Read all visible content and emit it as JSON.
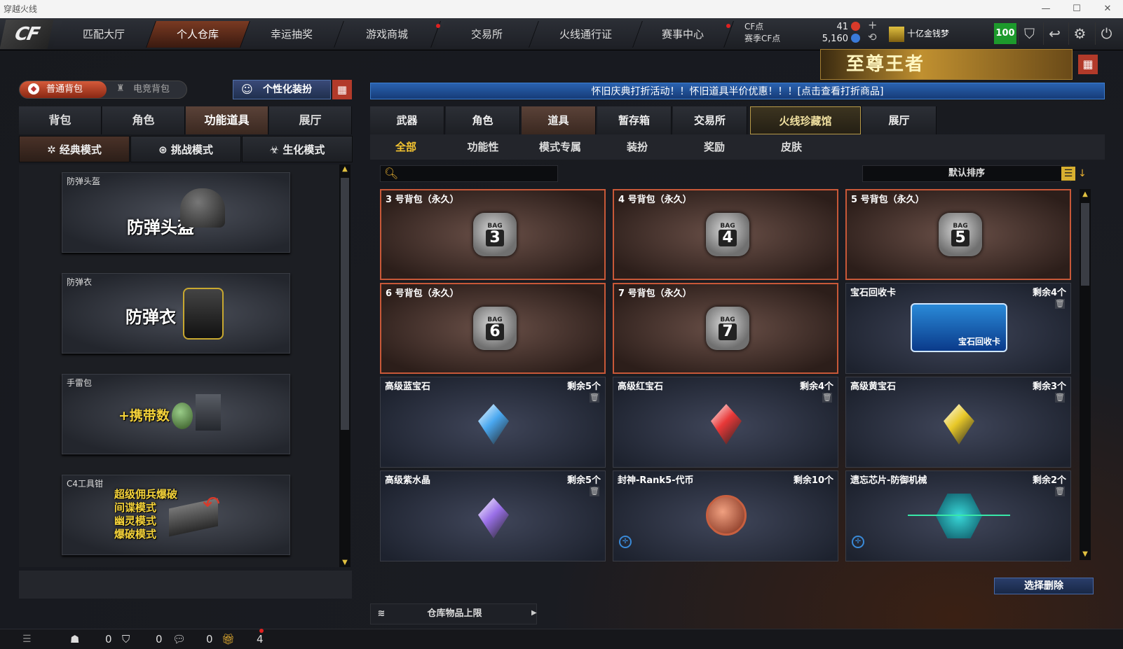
{
  "window": {
    "title": "穿越火线",
    "minimize": "—",
    "maximize": "☐",
    "close": "✕"
  },
  "nav": {
    "tabs": [
      {
        "label": "匹配大厅"
      },
      {
        "label": "个人仓库"
      },
      {
        "label": "幸运抽奖"
      },
      {
        "label": "游戏商城"
      },
      {
        "label": "交易所"
      },
      {
        "label": "火线通行证"
      },
      {
        "label": "赛事中心"
      }
    ]
  },
  "currency": {
    "cf_label": "CF点",
    "season_label": "赛季CF点",
    "cf_value": "41",
    "season_value": "5,160",
    "plus": "+",
    "refresh": "⟲"
  },
  "money": {
    "label": "十亿金钱梦"
  },
  "level": "100",
  "banner": {
    "text": "至尊王者"
  },
  "marquee": "怀旧庆典打折活动！！怀旧道具半价优惠！！！[点击查看打折商品]",
  "left": {
    "bag_normal": "普通背包",
    "bag_esport": "电竞背包",
    "customize": "个性化装扮",
    "tabs": [
      {
        "label": "背包"
      },
      {
        "label": "角色"
      },
      {
        "label": "功能道具"
      },
      {
        "label": "展厅"
      }
    ],
    "modes": [
      {
        "label": "经典模式"
      },
      {
        "label": "挑战模式"
      },
      {
        "label": "生化模式"
      }
    ],
    "items": [
      {
        "title": "防弹头盔",
        "art": "防弹头盔"
      },
      {
        "title": "防弹衣",
        "art": "防弹衣"
      },
      {
        "title": "手雷包",
        "art": "+携带数"
      },
      {
        "title": "C4工具钳",
        "art": "超级佣兵爆破\n间谍模式\n幽灵模式\n爆破模式"
      }
    ]
  },
  "right": {
    "tabs": [
      {
        "label": "武器"
      },
      {
        "label": "角色"
      },
      {
        "label": "道具"
      },
      {
        "label": "暂存箱"
      },
      {
        "label": "交易所"
      },
      {
        "label": "火线珍藏馆"
      },
      {
        "label": "展厅"
      }
    ],
    "subtabs": [
      {
        "label": "全部"
      },
      {
        "label": "功能性"
      },
      {
        "label": "模式专属"
      },
      {
        "label": "装扮"
      },
      {
        "label": "奖励"
      },
      {
        "label": "皮肤"
      }
    ],
    "search_placeholder": "",
    "sort": "默认排序",
    "cards": [
      {
        "title": "3 号背包（永久）",
        "count": "",
        "bag": "3"
      },
      {
        "title": "4 号背包（永久）",
        "count": "",
        "bag": "4"
      },
      {
        "title": "5 号背包（永久）",
        "count": "",
        "bag": "5"
      },
      {
        "title": "6 号背包（永久）",
        "count": "",
        "bag": "6"
      },
      {
        "title": "7 号背包（永久）",
        "count": "",
        "bag": "7"
      },
      {
        "title": "宝石回收卡",
        "count": "剩余4个",
        "art": "宝石回收卡"
      },
      {
        "title": "高级蓝宝石",
        "count": "剩余5个",
        "gem": "#4aa8f0"
      },
      {
        "title": "高级红宝石",
        "count": "剩余4个",
        "gem": "#e83838"
      },
      {
        "title": "高级黄宝石",
        "count": "剩余3个",
        "gem": "#e8c828"
      },
      {
        "title": "高级紫水晶",
        "count": "剩余5个",
        "gem": "#9a70e8"
      },
      {
        "title": "封神-Rank5-代币",
        "count": "剩余10个"
      },
      {
        "title": "遗忘芯片-防御机械",
        "count": "剩余2个"
      }
    ],
    "delete_btn": "选择删除",
    "capacity": "仓库物品上限"
  },
  "bottom": {
    "v1": "0",
    "v2": "0",
    "v3": "0",
    "v4": "4"
  }
}
